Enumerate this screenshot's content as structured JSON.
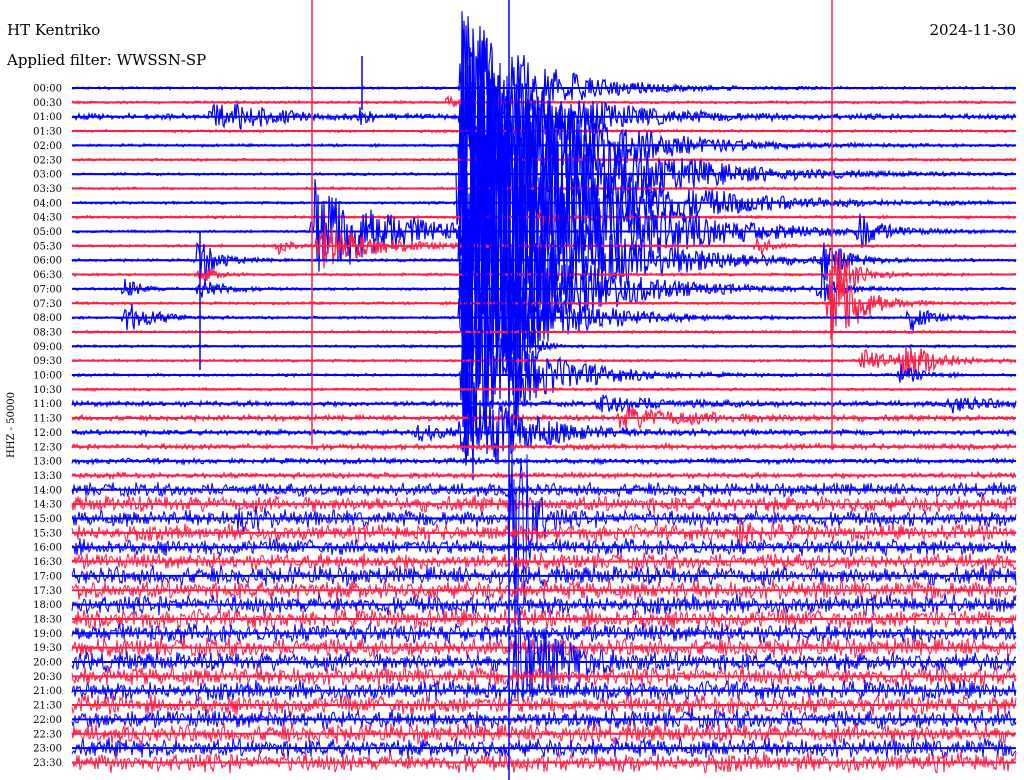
{
  "header": {
    "station": "HT Kentriko",
    "date": "2024-11-30",
    "filter": "Applied filter: WWSSN-SP"
  },
  "chart_data": {
    "type": "line",
    "title": "HT Kentriko",
    "subtitle": "Applied filter: WWSSN-SP",
    "date": "2024-11-30",
    "ylabel": "HHZ - 50000",
    "y_tick_labels": [
      "00:00",
      "00:30",
      "01:00",
      "01:30",
      "02:00",
      "02:30",
      "03:00",
      "03:30",
      "04:00",
      "04:30",
      "05:00",
      "05:30",
      "06:00",
      "06:30",
      "07:00",
      "07:30",
      "08:00",
      "08:30",
      "09:00",
      "09:30",
      "10:00",
      "10:30",
      "11:00",
      "11:30",
      "12:00",
      "12:30",
      "13:00",
      "13:30",
      "14:00",
      "14:30",
      "15:00",
      "15:30",
      "16:00",
      "16:30",
      "17:00",
      "17:30",
      "18:00",
      "18:30",
      "19:00",
      "19:30",
      "20:00",
      "20:30",
      "21:00",
      "21:30",
      "22:00",
      "22:30",
      "23:00",
      "23:30"
    ],
    "trace_colors": [
      "#0000ff",
      "#ff1e46"
    ],
    "noise_levels": [
      1,
      1,
      2,
      1,
      1,
      1,
      1,
      1,
      1,
      1,
      1,
      1,
      1,
      1,
      1,
      1,
      1,
      1,
      1,
      1,
      1,
      1,
      2,
      2,
      2,
      2,
      2,
      2,
      5,
      6,
      6,
      6,
      6,
      6,
      7,
      7,
      7,
      7,
      7,
      7,
      7,
      7,
      7,
      7,
      7,
      7,
      7,
      7
    ],
    "grid": false
  }
}
